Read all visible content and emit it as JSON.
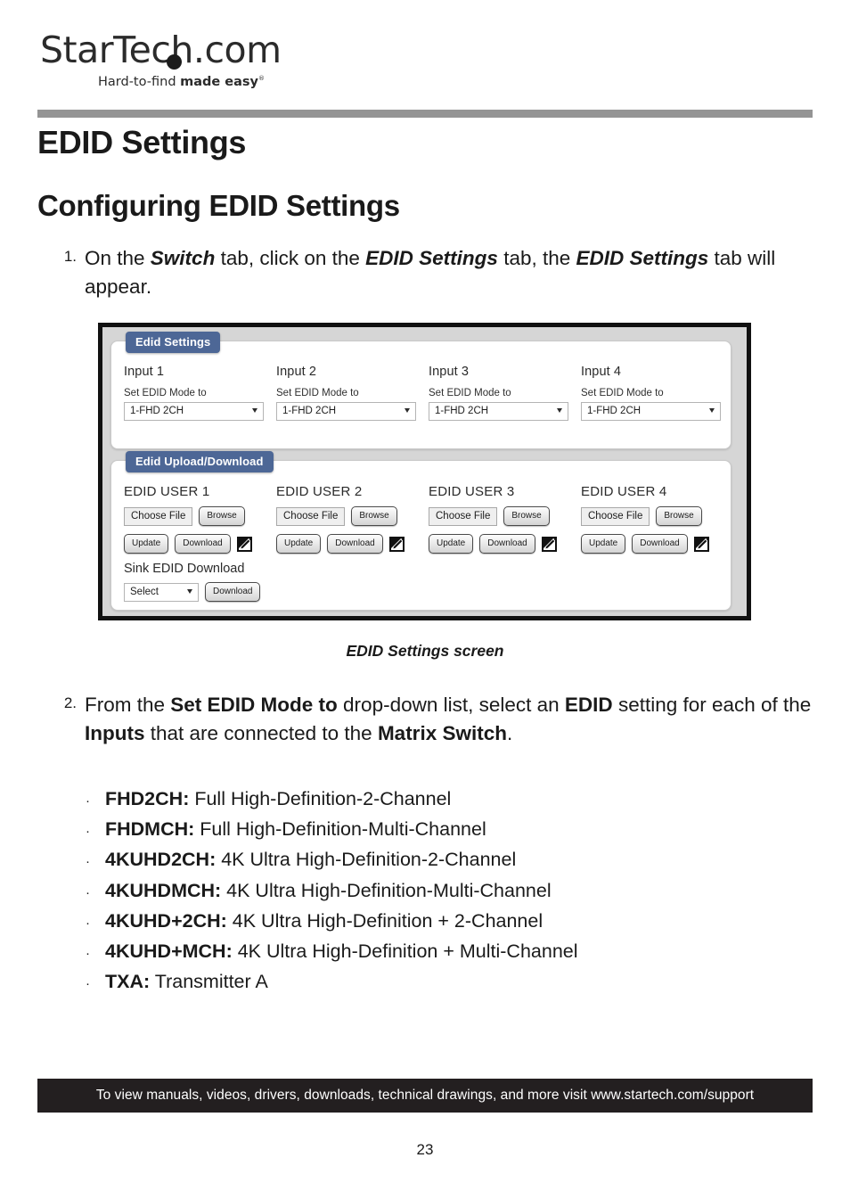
{
  "logo": {
    "brand_main": "StarTech",
    "brand_dot_suffix": ".com",
    "tagline_plain": "Hard-to-find ",
    "tagline_bold": "made easy",
    "tagline_mark": "®"
  },
  "headings": {
    "h1": "EDID Settings",
    "h2": "Configuring EDID Settings"
  },
  "steps": [
    {
      "number": "1.",
      "parts": [
        {
          "t": "On the ",
          "s": "plain"
        },
        {
          "t": "Switch",
          "s": "bi"
        },
        {
          "t": " tab, click on the ",
          "s": "plain"
        },
        {
          "t": "EDID Settings",
          "s": "bi"
        },
        {
          "t": " tab, the ",
          "s": "plain"
        },
        {
          "t": "EDID Settings",
          "s": "bi"
        },
        {
          "t": " tab will appear.",
          "s": "plain"
        }
      ]
    },
    {
      "number": "2.",
      "parts": [
        {
          "t": "From the ",
          "s": "plain"
        },
        {
          "t": "Set EDID Mode to",
          "s": "b"
        },
        {
          "t": " drop-down list, select an ",
          "s": "plain"
        },
        {
          "t": "EDID",
          "s": "b"
        },
        {
          "t": " setting for each of the ",
          "s": "plain"
        },
        {
          "t": "Inputs",
          "s": "b"
        },
        {
          "t": " that are connected to the ",
          "s": "plain"
        },
        {
          "t": "Matrix Switch",
          "s": "b"
        },
        {
          "t": ".",
          "s": "plain"
        }
      ]
    }
  ],
  "figure": {
    "caption": "EDID Settings screen",
    "edid_settings_card": {
      "tab_label": "Edid Settings",
      "columns": [
        {
          "title": "Input 1",
          "field_label": "Set EDID Mode to",
          "value": "1-FHD 2CH"
        },
        {
          "title": "Input 2",
          "field_label": "Set EDID Mode to",
          "value": "1-FHD 2CH"
        },
        {
          "title": "Input 3",
          "field_label": "Set EDID Mode to",
          "value": "1-FHD 2CH"
        },
        {
          "title": "Input 4",
          "field_label": "Set EDID Mode to",
          "value": "1-FHD 2CH"
        }
      ]
    },
    "edid_upload_card": {
      "tab_label": "Edid Upload/Download",
      "columns": [
        {
          "title": "EDID USER 1",
          "choose_file": "Choose File",
          "browse": "Browse",
          "update": "Update",
          "download": "Download"
        },
        {
          "title": "EDID USER 2",
          "choose_file": "Choose File",
          "browse": "Browse",
          "update": "Update",
          "download": "Download"
        },
        {
          "title": "EDID USER 3",
          "choose_file": "Choose File",
          "browse": "Browse",
          "update": "Update",
          "download": "Download"
        },
        {
          "title": "EDID USER 4",
          "choose_file": "Choose File",
          "browse": "Browse",
          "update": "Update",
          "download": "Download"
        }
      ],
      "sink": {
        "title": "Sink EDID Download",
        "select_value": "Select",
        "download": "Download"
      }
    }
  },
  "bullets": [
    {
      "term": "FHD2CH:",
      "desc": " Full High-Definition-2-Channel"
    },
    {
      "term": "FHDMCH:",
      "desc": " Full High-Definition-Multi-Channel"
    },
    {
      "term": "4KUHD2CH:",
      "desc": " 4K Ultra High-Definition-2-Channel"
    },
    {
      "term": "4KUHDMCH:",
      "desc": " 4K Ultra High-Definition-Multi-Channel"
    },
    {
      "term": "4KUHD+2CH:",
      "desc": " 4K Ultra High-Definition + 2-Channel"
    },
    {
      "term": "4KUHD+MCH:",
      "desc": " 4K Ultra High-Definition + Multi-Channel"
    },
    {
      "term": "TXA:",
      "desc": " Transmitter A"
    }
  ],
  "footer": {
    "text": "To view manuals, videos, drivers, downloads, technical drawings, and more visit www.startech.com/support",
    "page_number": "23"
  },
  "colors": {
    "tab_blue": "#4d6796",
    "divider_gray": "#949494",
    "footer_black": "#231f20",
    "figure_bg": "#d6d6d6"
  }
}
